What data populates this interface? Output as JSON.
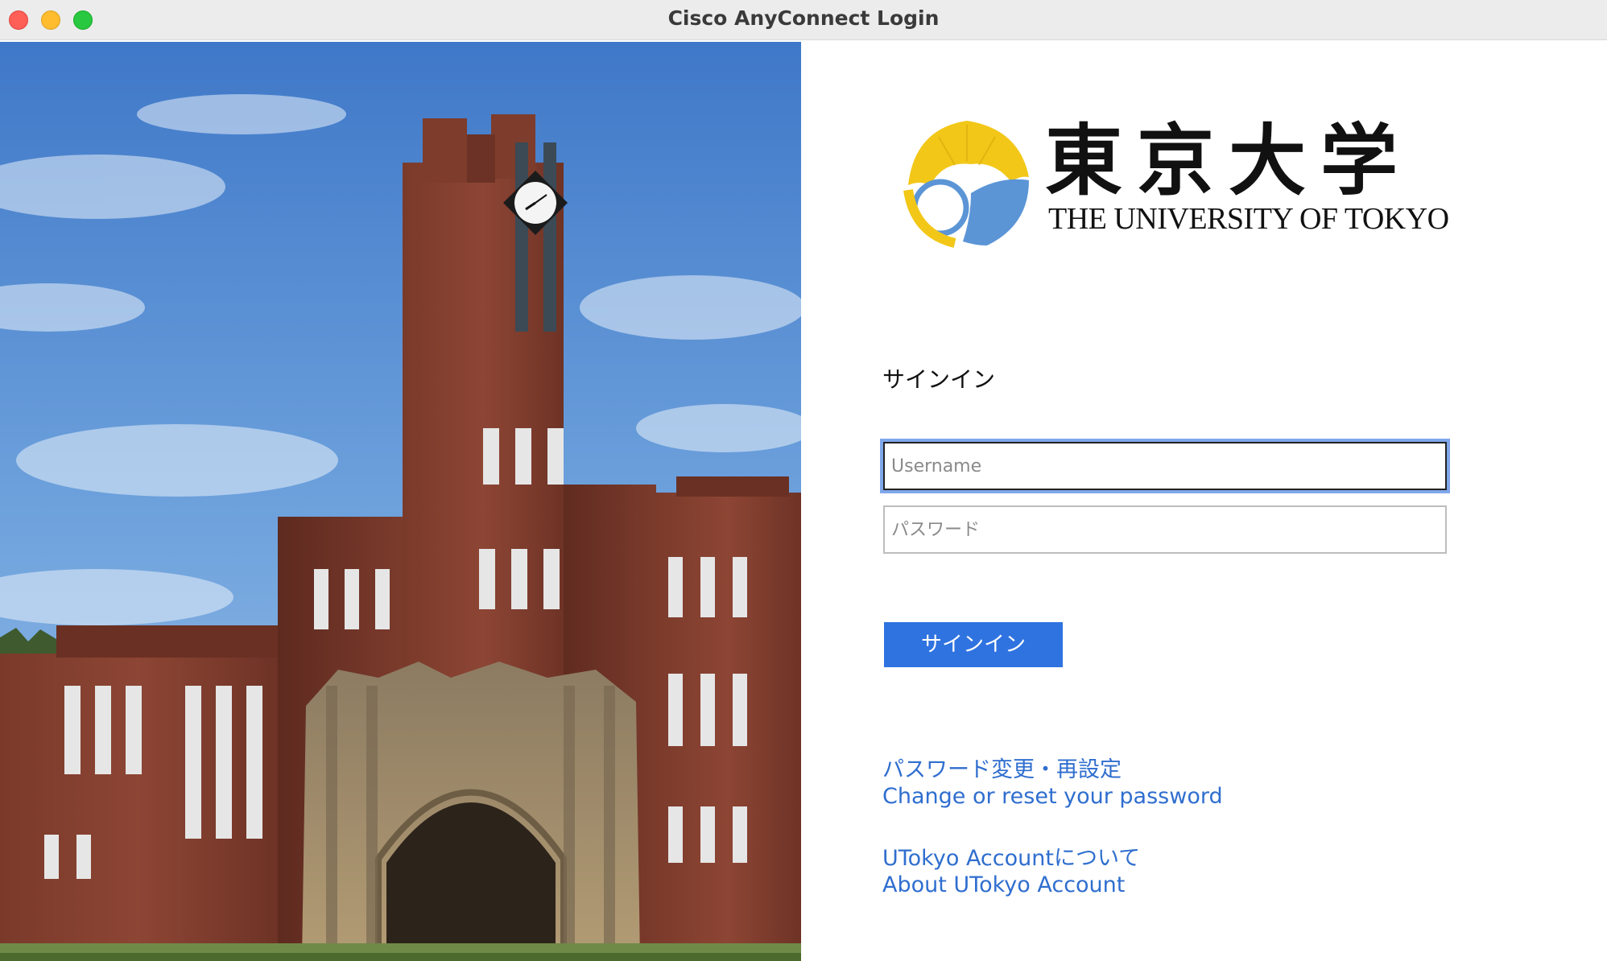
{
  "window": {
    "title": "Cisco AnyConnect Login"
  },
  "logo": {
    "kanji": "東京大学",
    "english": "THE UNIVERSITY OF TOKYO"
  },
  "form": {
    "heading": "サインイン",
    "username_placeholder": "Username",
    "password_placeholder": "パスワード",
    "signin_label": "サインイン"
  },
  "links": {
    "password_ja": "パスワード変更・再設定",
    "password_en": "Change or reset your password",
    "account_ja": "UTokyo Accountについて",
    "account_en": "About UTokyo Account"
  },
  "colors": {
    "accent": "#2f73e0",
    "link": "#2f6ecf",
    "logo_yellow": "#f2c718",
    "logo_blue": "#5b95d6"
  }
}
